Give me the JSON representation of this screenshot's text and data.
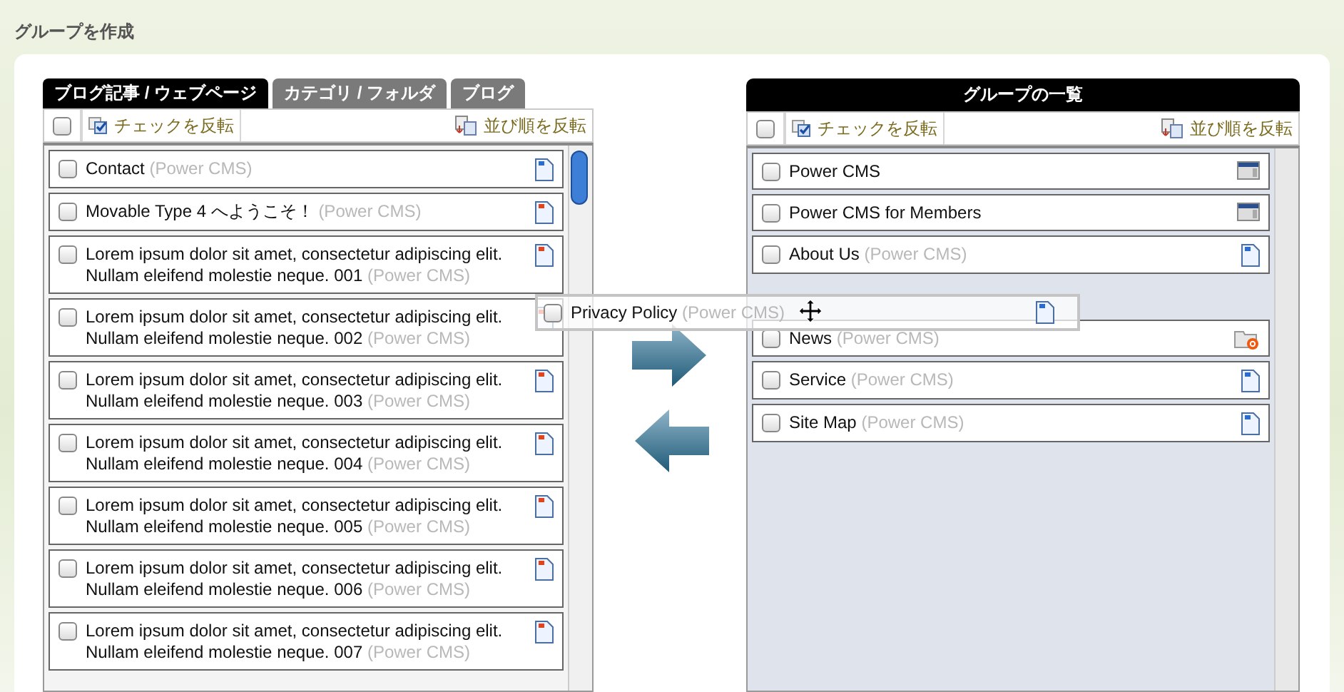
{
  "page_title": "グループを作成",
  "source_panel": {
    "tabs": [
      {
        "label": "ブログ記事 / ウェブページ",
        "selected": true
      },
      {
        "label": "カテゴリ / フォルダ",
        "selected": false
      },
      {
        "label": "ブログ",
        "selected": false
      }
    ],
    "toolbar": {
      "select_all_checked": false,
      "invert_check": "チェックを反転",
      "reverse_order": "並び順を反転"
    },
    "items": [
      {
        "title": "Contact",
        "source": "(Power CMS)",
        "kind": "page",
        "checked": false
      },
      {
        "title": "Movable Type 4 へようこそ！",
        "source": "(Power CMS)",
        "kind": "entry",
        "checked": false
      },
      {
        "title": "Lorem ipsum dolor sit amet, consectetur adipiscing elit. Nullam eleifend molestie neque. 001",
        "source": "(Power CMS)",
        "kind": "entry",
        "checked": false
      },
      {
        "title": "Lorem ipsum dolor sit amet, consectetur adipiscing elit. Nullam eleifend molestie neque. 002",
        "source": "(Power CMS)",
        "kind": "entry",
        "checked": false
      },
      {
        "title": "Lorem ipsum dolor sit amet, consectetur adipiscing elit. Nullam eleifend molestie neque. 003",
        "source": "(Power CMS)",
        "kind": "entry",
        "checked": false
      },
      {
        "title": "Lorem ipsum dolor sit amet, consectetur adipiscing elit. Nullam eleifend molestie neque. 004",
        "source": "(Power CMS)",
        "kind": "entry",
        "checked": false
      },
      {
        "title": "Lorem ipsum dolor sit amet, consectetur adipiscing elit. Nullam eleifend molestie neque. 005",
        "source": "(Power CMS)",
        "kind": "entry",
        "checked": false
      },
      {
        "title": "Lorem ipsum dolor sit amet, consectetur adipiscing elit. Nullam eleifend molestie neque. 006",
        "source": "(Power CMS)",
        "kind": "entry",
        "checked": false
      },
      {
        "title": "Lorem ipsum dolor sit amet, consectetur adipiscing elit. Nullam eleifend molestie neque. 007",
        "source": "(Power CMS)",
        "kind": "entry",
        "checked": false
      }
    ]
  },
  "group_panel": {
    "title": "グループの一覧",
    "toolbar": {
      "select_all_checked": false,
      "invert_check": "チェックを反転",
      "reverse_order": "並び順を反転"
    },
    "items": [
      {
        "title": "Power CMS",
        "kind": "blog",
        "checked": false
      },
      {
        "title": "Power CMS for Members",
        "kind": "blog",
        "checked": false
      },
      {
        "title": "About Us",
        "source": "(Power CMS)",
        "kind": "page",
        "checked": false
      },
      {
        "kind": "slot"
      },
      {
        "title": "News",
        "source": "(Power CMS)",
        "kind": "folder",
        "checked": false
      },
      {
        "title": "Service",
        "source": "(Power CMS)",
        "kind": "page",
        "checked": false
      },
      {
        "title": "Site Map",
        "source": "(Power CMS)",
        "kind": "page",
        "checked": false
      }
    ]
  },
  "dragged_item": {
    "title": "Privacy Policy",
    "source": "(Power CMS)",
    "kind": "page",
    "checked": false
  }
}
